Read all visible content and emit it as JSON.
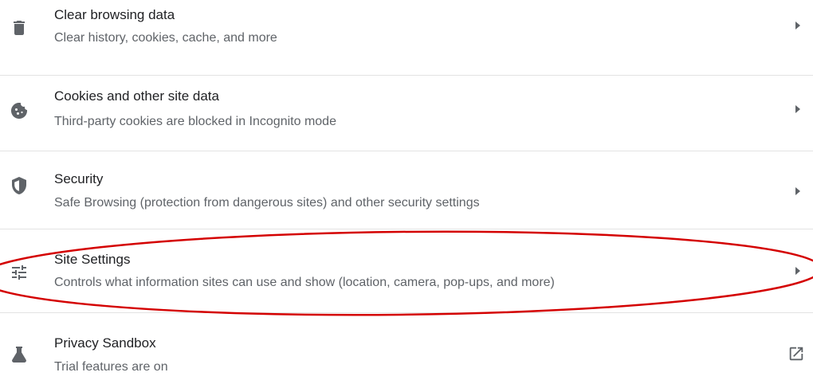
{
  "settings_list": {
    "items": [
      {
        "icon": "trash-icon",
        "title": "Clear browsing data",
        "subtitle": "Clear history, cookies, cache, and more",
        "action": "arrow"
      },
      {
        "icon": "cookie-icon",
        "title": "Cookies and other site data",
        "subtitle": "Third-party cookies are blocked in Incognito mode",
        "action": "arrow"
      },
      {
        "icon": "shield-icon",
        "title": "Security",
        "subtitle": "Safe Browsing (protection from dangerous sites) and other security settings",
        "action": "arrow"
      },
      {
        "icon": "sliders-icon",
        "title": "Site Settings",
        "subtitle": "Controls what information sites can use and show (location, camera, pop-ups, and more)",
        "action": "arrow"
      },
      {
        "icon": "flask-icon",
        "title": "Privacy Sandbox",
        "subtitle": "Trial features are on",
        "action": "external-link"
      }
    ]
  },
  "annotation": {
    "highlighted_item": "Site Settings",
    "color": "#d40000"
  },
  "colors": {
    "title_text": "#202124",
    "subtitle_text": "#5f6368",
    "icon": "#5f6368",
    "divider": "#e3e3e3"
  }
}
